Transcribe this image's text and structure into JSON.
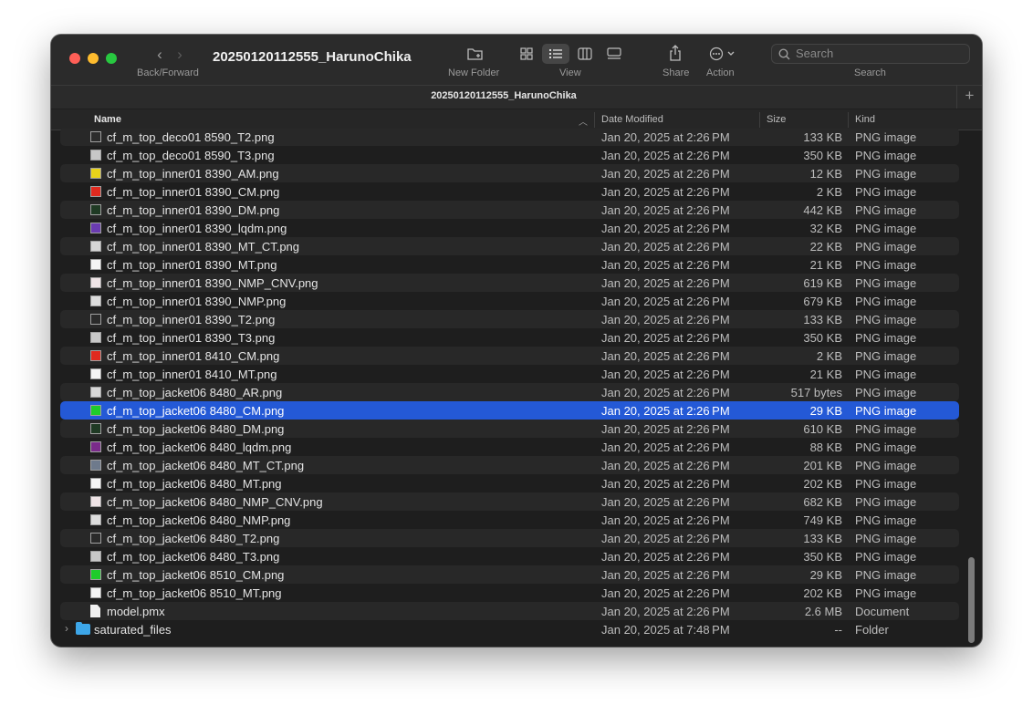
{
  "window": {
    "title": "20250120112555_HarunoChika",
    "tab_title": "20250120112555_HarunoChika"
  },
  "toolbar": {
    "back_forward_label": "Back/Forward",
    "new_folder_label": "New Folder",
    "view_label": "View",
    "share_label": "Share",
    "action_label": "Action",
    "search_label": "Search",
    "search_placeholder": "Search"
  },
  "columns": {
    "name": "Name",
    "date_modified": "Date Modified",
    "size": "Size",
    "kind": "Kind"
  },
  "files": [
    {
      "name": "cf_m_top_deco01 8590_T2.png",
      "date": "Jan 20, 2025 at 2:26 PM",
      "size": "133 KB",
      "kind": "PNG image",
      "icon": "image-thumb-dark",
      "swatch": "#2c2c2c"
    },
    {
      "name": "cf_m_top_deco01 8590_T3.png",
      "date": "Jan 20, 2025 at 2:26 PM",
      "size": "350 KB",
      "kind": "PNG image",
      "icon": "image-thumb-gray",
      "swatch": "#c8c8c8"
    },
    {
      "name": "cf_m_top_inner01 8390_AM.png",
      "date": "Jan 20, 2025 at 2:26 PM",
      "size": "12 KB",
      "kind": "PNG image",
      "icon": "image-thumb-yellow",
      "swatch": "#e8d21a"
    },
    {
      "name": "cf_m_top_inner01 8390_CM.png",
      "date": "Jan 20, 2025 at 2:26 PM",
      "size": "2 KB",
      "kind": "PNG image",
      "icon": "image-thumb-red",
      "swatch": "#e02a1f"
    },
    {
      "name": "cf_m_top_inner01 8390_DM.png",
      "date": "Jan 20, 2025 at 2:26 PM",
      "size": "442 KB",
      "kind": "PNG image",
      "icon": "image-thumb-dark",
      "swatch": "#1f3a24"
    },
    {
      "name": "cf_m_top_inner01 8390_lqdm.png",
      "date": "Jan 20, 2025 at 2:26 PM",
      "size": "32 KB",
      "kind": "PNG image",
      "icon": "image-thumb-multicolor",
      "swatch": "#6a3bb0"
    },
    {
      "name": "cf_m_top_inner01 8390_MT_CT.png",
      "date": "Jan 20, 2025 at 2:26 PM",
      "size": "22 KB",
      "kind": "PNG image",
      "icon": "image-thumb-lightgray",
      "swatch": "#d6d6d6"
    },
    {
      "name": "cf_m_top_inner01 8390_MT.png",
      "date": "Jan 20, 2025 at 2:26 PM",
      "size": "21 KB",
      "kind": "PNG image",
      "icon": "image-thumb-white",
      "swatch": "#f5f5f5"
    },
    {
      "name": "cf_m_top_inner01 8390_NMP_CNV.png",
      "date": "Jan 20, 2025 at 2:26 PM",
      "size": "619 KB",
      "kind": "PNG image",
      "icon": "image-thumb-pinkwhite",
      "swatch": "#efe4e6"
    },
    {
      "name": "cf_m_top_inner01 8390_NMP.png",
      "date": "Jan 20, 2025 at 2:26 PM",
      "size": "679 KB",
      "kind": "PNG image",
      "icon": "image-thumb-lightgray",
      "swatch": "#dcdcdc"
    },
    {
      "name": "cf_m_top_inner01 8390_T2.png",
      "date": "Jan 20, 2025 at 2:26 PM",
      "size": "133 KB",
      "kind": "PNG image",
      "icon": "image-thumb-dark",
      "swatch": "#2a2a2a"
    },
    {
      "name": "cf_m_top_inner01 8390_T3.png",
      "date": "Jan 20, 2025 at 2:26 PM",
      "size": "350 KB",
      "kind": "PNG image",
      "icon": "image-thumb-gray",
      "swatch": "#c8c8c8"
    },
    {
      "name": "cf_m_top_inner01 8410_CM.png",
      "date": "Jan 20, 2025 at 2:26 PM",
      "size": "2 KB",
      "kind": "PNG image",
      "icon": "image-thumb-red",
      "swatch": "#e02a1f"
    },
    {
      "name": "cf_m_top_inner01 8410_MT.png",
      "date": "Jan 20, 2025 at 2:26 PM",
      "size": "21 KB",
      "kind": "PNG image",
      "icon": "image-thumb-white",
      "swatch": "#f5f5f5"
    },
    {
      "name": "cf_m_top_jacket06 8480_AR.png",
      "date": "Jan 20, 2025 at 2:26 PM",
      "size": "517 bytes",
      "kind": "PNG image",
      "icon": "image-thumb-strip",
      "swatch": "#d8d8d8"
    },
    {
      "name": "cf_m_top_jacket06 8480_CM.png",
      "date": "Jan 20, 2025 at 2:26 PM",
      "size": "29 KB",
      "kind": "PNG image",
      "icon": "image-thumb-green",
      "swatch": "#1fcc2a",
      "selected": true
    },
    {
      "name": "cf_m_top_jacket06 8480_DM.png",
      "date": "Jan 20, 2025 at 2:26 PM",
      "size": "610 KB",
      "kind": "PNG image",
      "icon": "image-thumb-dark",
      "swatch": "#1f3a24"
    },
    {
      "name": "cf_m_top_jacket06 8480_lqdm.png",
      "date": "Jan 20, 2025 at 2:26 PM",
      "size": "88 KB",
      "kind": "PNG image",
      "icon": "image-thumb-multicolor",
      "swatch": "#7a2b8a"
    },
    {
      "name": "cf_m_top_jacket06 8480_MT_CT.png",
      "date": "Jan 20, 2025 at 2:26 PM",
      "size": "201 KB",
      "kind": "PNG image",
      "icon": "image-thumb-slate",
      "swatch": "#6e7a8c"
    },
    {
      "name": "cf_m_top_jacket06 8480_MT.png",
      "date": "Jan 20, 2025 at 2:26 PM",
      "size": "202 KB",
      "kind": "PNG image",
      "icon": "image-thumb-white",
      "swatch": "#f5f5f5"
    },
    {
      "name": "cf_m_top_jacket06 8480_NMP_CNV.png",
      "date": "Jan 20, 2025 at 2:26 PM",
      "size": "682 KB",
      "kind": "PNG image",
      "icon": "image-thumb-pinkwhite",
      "swatch": "#efe4e6"
    },
    {
      "name": "cf_m_top_jacket06 8480_NMP.png",
      "date": "Jan 20, 2025 at 2:26 PM",
      "size": "749 KB",
      "kind": "PNG image",
      "icon": "image-thumb-lightgray",
      "swatch": "#dcdcdc"
    },
    {
      "name": "cf_m_top_jacket06 8480_T2.png",
      "date": "Jan 20, 2025 at 2:26 PM",
      "size": "133 KB",
      "kind": "PNG image",
      "icon": "image-thumb-dark",
      "swatch": "#2a2a2a"
    },
    {
      "name": "cf_m_top_jacket06 8480_T3.png",
      "date": "Jan 20, 2025 at 2:26 PM",
      "size": "350 KB",
      "kind": "PNG image",
      "icon": "image-thumb-gray",
      "swatch": "#c8c8c8"
    },
    {
      "name": "cf_m_top_jacket06 8510_CM.png",
      "date": "Jan 20, 2025 at 2:26 PM",
      "size": "29 KB",
      "kind": "PNG image",
      "icon": "image-thumb-green",
      "swatch": "#1fcc2a"
    },
    {
      "name": "cf_m_top_jacket06 8510_MT.png",
      "date": "Jan 20, 2025 at 2:26 PM",
      "size": "202 KB",
      "kind": "PNG image",
      "icon": "image-thumb-white",
      "swatch": "#f5f5f5"
    },
    {
      "name": "model.pmx",
      "date": "Jan 20, 2025 at 2:26 PM",
      "size": "2.6 MB",
      "kind": "Document",
      "icon": "document-icon"
    },
    {
      "name": "saturated_files",
      "date": "Jan 20, 2025 at 7:48 PM",
      "size": "--",
      "kind": "Folder",
      "icon": "folder-icon",
      "folder": true
    }
  ],
  "colors": {
    "selection": "#2459d6",
    "folder": "#3da6e8"
  }
}
